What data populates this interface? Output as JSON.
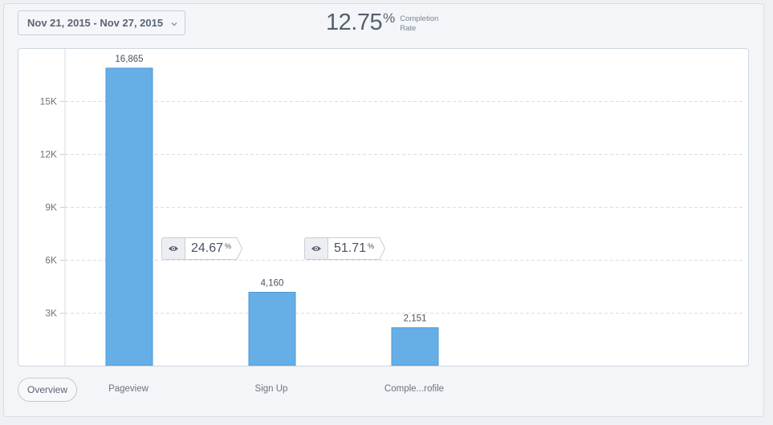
{
  "header": {
    "date_range": "Nov 21, 2015 - Nov 27, 2015",
    "completion_rate_value": "12.75",
    "completion_rate_unit": "%",
    "completion_rate_label_line1": "Completion",
    "completion_rate_label_line2": "Rate"
  },
  "chart_data": {
    "type": "bar",
    "categories": [
      "Pageview",
      "Sign Up",
      "Comple...rofile"
    ],
    "values": [
      16865,
      4160,
      2151
    ],
    "data_labels": [
      "16,865",
      "4,160",
      "2,151"
    ],
    "ylim": [
      0,
      18000
    ],
    "yticks": [
      3000,
      6000,
      9000,
      12000,
      15000
    ],
    "ytick_labels": [
      "3K",
      "6K",
      "9K",
      "12K",
      "15K"
    ],
    "grid": true,
    "bar_color": "#66aee6",
    "conversions": [
      {
        "value": "24.67",
        "unit": "%"
      },
      {
        "value": "51.71",
        "unit": "%"
      }
    ]
  },
  "footer": {
    "overview_label": "Overview",
    "step_labels": [
      "Pageview",
      "Sign Up",
      "Comple...rofile"
    ]
  },
  "icons": {
    "dropdown": "chevron-down-icon",
    "conversion": "eye-icon"
  }
}
